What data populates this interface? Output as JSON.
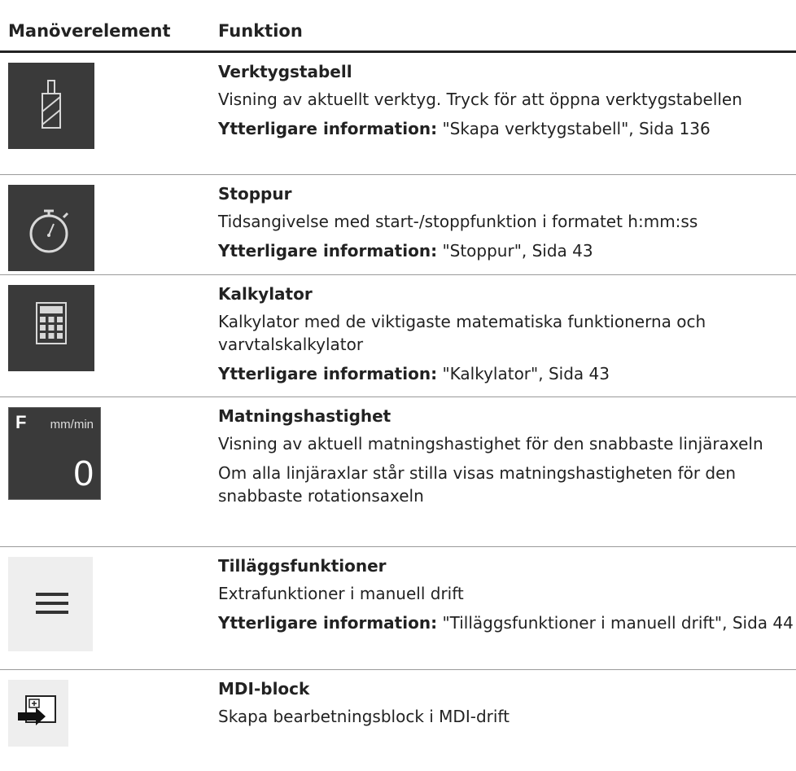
{
  "header": {
    "col1": "Manöverelement",
    "col2": "Funktion"
  },
  "rows": [
    {
      "icon": "tool-icon",
      "name": "Verktygstabell",
      "lines": [
        "Visning av aktuellt verktyg. Tryck för att öppna verktygstabellen"
      ],
      "info_label": "Ytterligare information:",
      "info_text": "\"Skapa verktygstabell\", Sida 136"
    },
    {
      "icon": "stopwatch-icon",
      "name": "Stoppur",
      "lines": [
        "Tidsangivelse med start-/stoppfunktion i formatet h:mm:ss"
      ],
      "info_label": "Ytterligare information:",
      "info_text": "\"Stoppur\", Sida 43"
    },
    {
      "icon": "calculator-icon",
      "name": "Kalkylator",
      "lines": [
        "Kalkylator med de viktigaste matematiska funktionerna och varvtalskalkylator"
      ],
      "info_label": "Ytterligare information:",
      "info_text": "\"Kalkylator\", Sida 43"
    },
    {
      "icon": "feed-rate-display",
      "name": "Matningshastighet",
      "feed": {
        "letter": "F",
        "unit": "mm/min",
        "value": "0"
      },
      "lines": [
        "Visning av aktuell matningshastighet för den snabbaste linjäraxeln",
        "Om alla linjäraxlar står stilla visas matningshastigheten för den snabbaste rotationsaxeln"
      ]
    },
    {
      "icon": "menu-icon",
      "name": "Tilläggsfunktioner",
      "lines": [
        "Extrafunktioner i manuell drift"
      ],
      "info_label": "Ytterligare information:",
      "info_text": "\"Tilläggsfunktioner i manuell drift\", Sida 44"
    },
    {
      "icon": "mdi-block-icon",
      "name": "MDI-block",
      "lines": [
        "Skapa bearbetningsblock i MDI-drift"
      ]
    }
  ]
}
